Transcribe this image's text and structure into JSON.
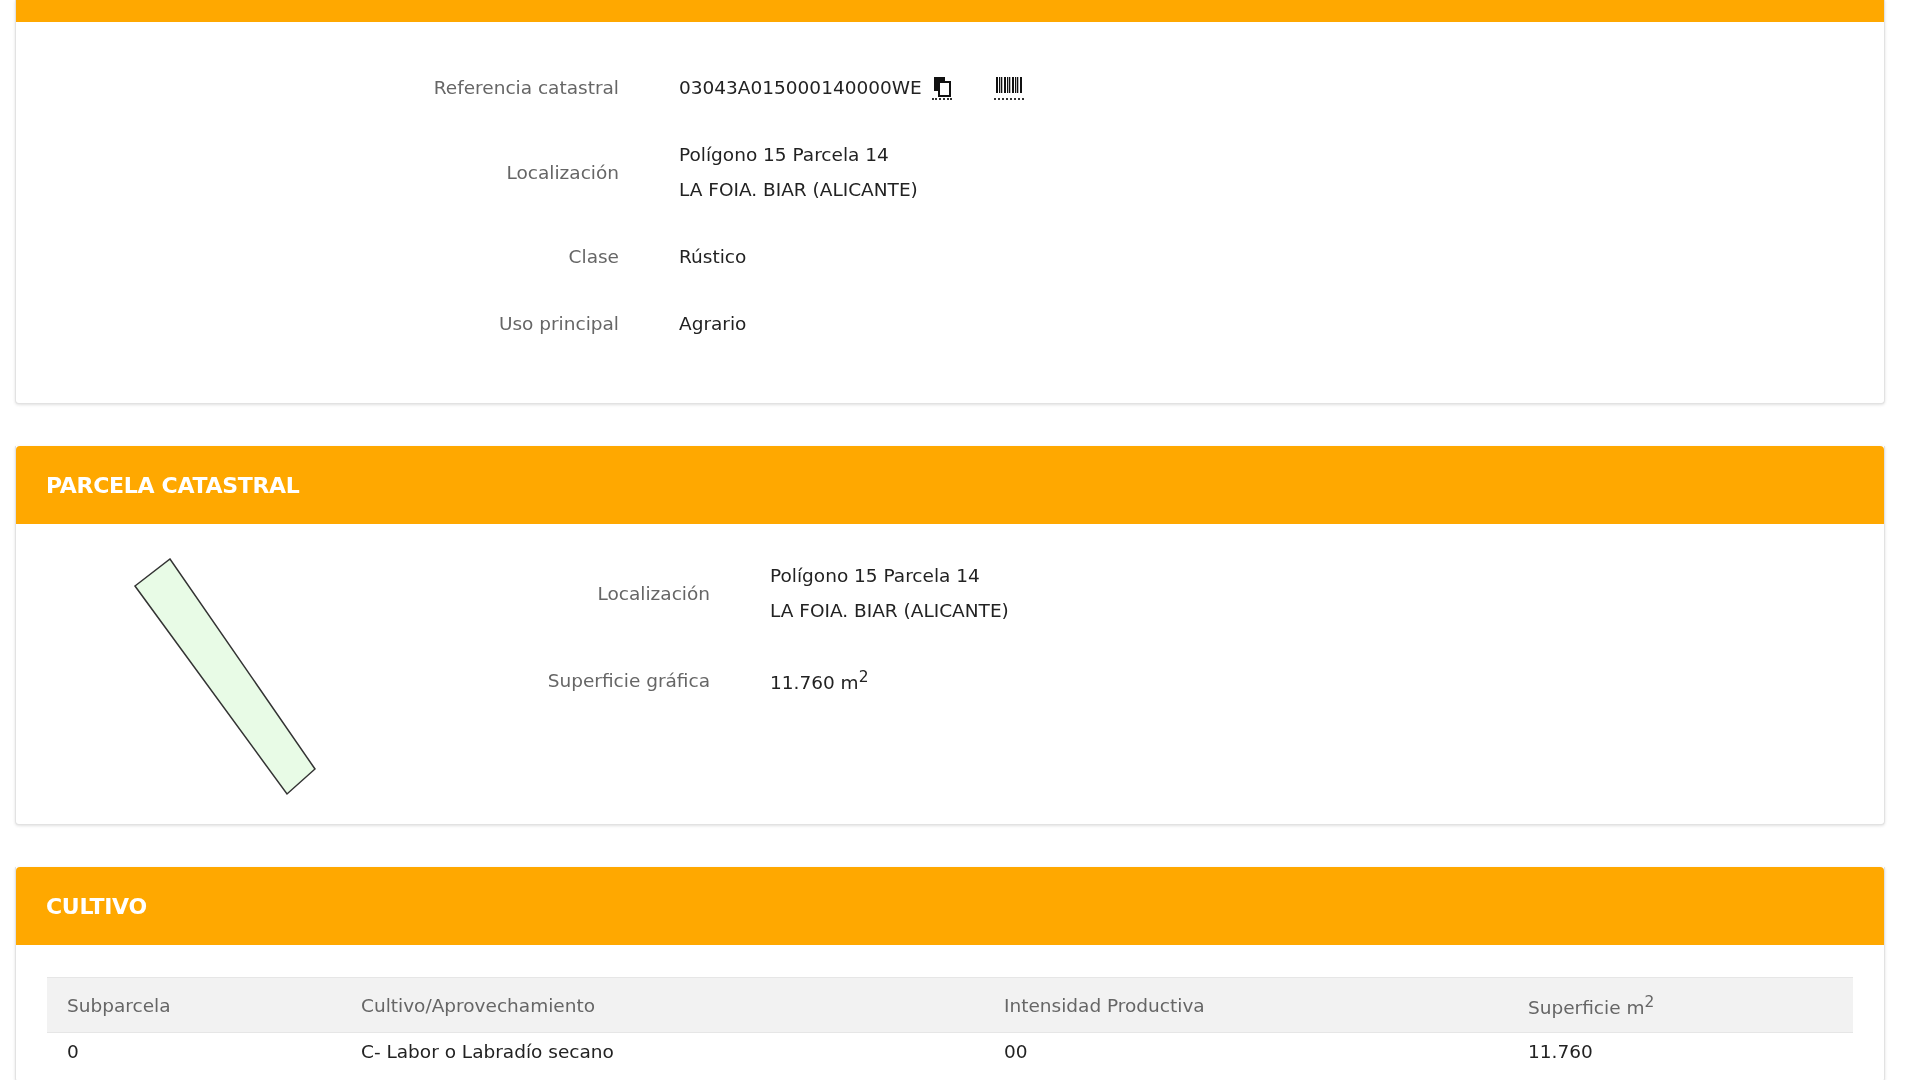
{
  "sections": [
    {
      "kind": "fields",
      "rows": [
        {
          "kind": "reference",
          "label": "Referencia catastral",
          "lines": [
            "03043A015000140000WE"
          ]
        },
        {
          "kind": "text",
          "label": "Localización",
          "lines": [
            "Polígono 15 Parcela 14",
            "LA FOIA. BIAR (ALICANTE)"
          ]
        },
        {
          "kind": "text",
          "label": "Clase",
          "lines": [
            "Rústico"
          ]
        },
        {
          "kind": "text",
          "label": "Uso principal",
          "lines": [
            "Agrario"
          ]
        }
      ]
    },
    {
      "kind": "parcel",
      "title": "PARCELA CATASTRAL",
      "rows": [
        {
          "kind": "text",
          "label": "Localización",
          "lines": [
            "Polígono 15 Parcela 14",
            "LA FOIA. BIAR (ALICANTE)"
          ]
        },
        {
          "kind": "text",
          "label": "Superficie gráfica",
          "lines": [
            "11.760 m$^{2}$"
          ]
        }
      ]
    },
    {
      "kind": "table",
      "title": "CULTIVO",
      "columns": [
        "Subparcela",
        "Cultivo/Aprovechamiento",
        "Intensidad Productiva",
        "Superficie m$^{2}$"
      ],
      "rows": [
        [
          "0",
          "C- Labor o Labradío secano",
          "00",
          "11.760"
        ]
      ]
    }
  ]
}
